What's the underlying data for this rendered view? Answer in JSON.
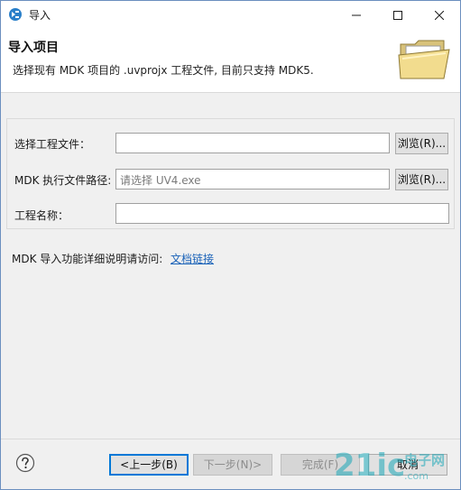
{
  "window": {
    "title": "导入"
  },
  "header": {
    "title": "导入项目",
    "description": "选择现有 MDK 项目的 .uvprojx 工程文件, 目前只支持 MDK5."
  },
  "form": {
    "project_file": {
      "label": "选择工程文件：",
      "value": "",
      "browse_label": "浏览(R)..."
    },
    "mdk_exe": {
      "label": "MDK 执行文件路径:",
      "placeholder": "请选择 UV4.exe",
      "browse_label": "浏览(R)..."
    },
    "project_name": {
      "label": "工程名称：",
      "value": ""
    }
  },
  "info": {
    "text": "MDK 导入功能详细说明请访问:",
    "link_text": "文档链接"
  },
  "footer": {
    "back_label": "<上一步(B)",
    "next_label": "下一步(N)>",
    "finish_label": "完成(F)",
    "cancel_label": "取消"
  },
  "colors": {
    "link": "#1a62b8",
    "focus": "#0078d7",
    "watermark_teal": "#1aa8b8"
  },
  "icons": [
    "eclipse-app-icon",
    "minimize-icon",
    "maximize-icon",
    "close-icon",
    "folder-open-icon",
    "help-icon"
  ]
}
